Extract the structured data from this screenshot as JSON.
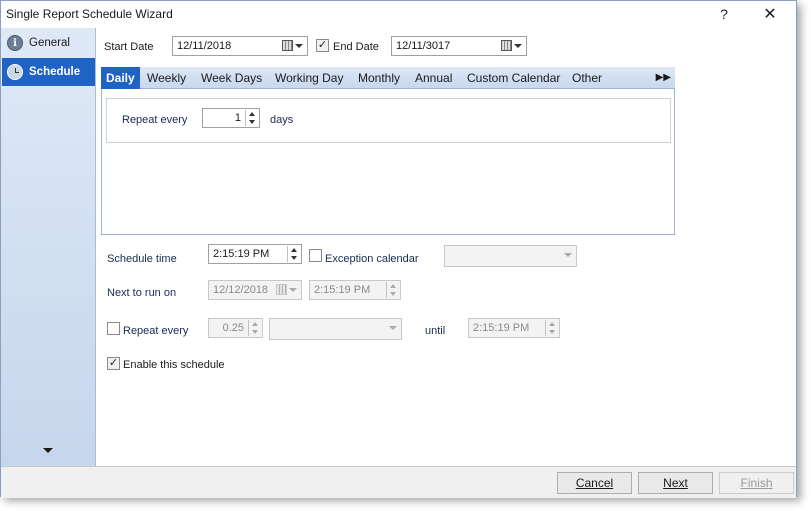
{
  "window": {
    "title": "Single Report Schedule Wizard",
    "help": "?",
    "close": "✕"
  },
  "sidebar": {
    "items": [
      {
        "label": "General",
        "icon": "info-icon",
        "icon_glyph": "i",
        "active": false
      },
      {
        "label": "Schedule",
        "icon": "clock-icon",
        "active": true
      }
    ]
  },
  "dates": {
    "start_label": "Start Date",
    "start_value": "12/11/2018",
    "end_checked": true,
    "end_label": "End Date",
    "end_value": "12/11/3017"
  },
  "tabs": {
    "items": [
      "Daily",
      "Weekly",
      "Week Days",
      "Working Day",
      "Monthly",
      "Annual",
      "Custom Calendar",
      "Other"
    ],
    "active": "Daily",
    "more": "▶▶"
  },
  "daily": {
    "repeat_label": "Repeat every",
    "repeat_value": "1",
    "unit": "days"
  },
  "schedule": {
    "time_label": "Schedule time",
    "time_value": "2:15:19 PM",
    "exception_label": "Exception calendar",
    "exception_checked": false,
    "exception_value": "",
    "next_label": "Next to run on",
    "next_date": "12/12/2018",
    "next_time": "2:15:19 PM",
    "repeat_label": "Repeat every",
    "repeat_checked": false,
    "repeat_value": "0.25",
    "repeat_unit": "",
    "until_label": "until",
    "until_value": "2:15:19 PM",
    "enable_label": "Enable this schedule",
    "enable_checked": true
  },
  "footer": {
    "cancel": "Cancel",
    "next": "Next",
    "finish": "Finish"
  },
  "colors": {
    "accent": "#1f64c4",
    "sidebar_bg": "#dfe9f6"
  }
}
